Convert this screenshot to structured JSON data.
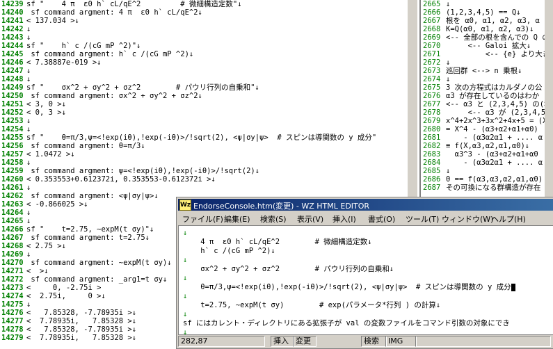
{
  "left_pane": {
    "lines": [
      {
        "num": "14239",
        "text": "sf \"    4 π  ε0 h` cL/qE^2         # 微細構造定数\"↓"
      },
      {
        "num": "14240",
        "text": " sf command argment: 4 π  ε0 h` cL/qE^2↓"
      },
      {
        "num": "14241",
        "text": "< 137.034 >↓"
      },
      {
        "num": "14242",
        "text": "↓"
      },
      {
        "num": "14243",
        "text": "↓"
      },
      {
        "num": "14244",
        "text": "sf \"    h` c /(cG mP ^2)\"↓"
      },
      {
        "num": "14245",
        "text": " sf command argment: h` c /(cG mP ^2)↓"
      },
      {
        "num": "14246",
        "text": "< 7.38887e-019 >↓"
      },
      {
        "num": "14247",
        "text": "↓"
      },
      {
        "num": "14248",
        "text": "↓"
      },
      {
        "num": "14249",
        "text": "sf \"    σx^2 + σy^2 + σz^2        # パウリ行列の自乗和\"↓"
      },
      {
        "num": "14250",
        "text": " sf command argment: σx^2 + σy^2 + σz^2↓"
      },
      {
        "num": "14251",
        "text": "< 3, 0 >↓"
      },
      {
        "num": "14252",
        "text": "< 0, 3 >↓"
      },
      {
        "num": "14253",
        "text": "↓"
      },
      {
        "num": "14254",
        "text": "↓"
      },
      {
        "num": "14255",
        "text": "sf \"    θ=π/3,ψ=<!exp(iθ),!exp(-iθ)>/!sqrt(2), <ψ|σy|ψ>  # スピンは導関数の y 成分\""
      },
      {
        "num": "14256",
        "text": " sf command argment: θ=π/3↓"
      },
      {
        "num": "14257",
        "text": "< 1.0472 >↓"
      },
      {
        "num": "14258",
        "text": "↓"
      },
      {
        "num": "14259",
        "text": " sf command argment: ψ=<!exp(iθ),!exp(-iθ)>/!sqrt(2)↓"
      },
      {
        "num": "14260",
        "text": "< 0.353553+0.612372i, 0.353553-0.612372i >↓"
      },
      {
        "num": "14261",
        "text": "↓"
      },
      {
        "num": "14262",
        "text": " sf command argment: <ψ|σy|ψ>↓"
      },
      {
        "num": "14263",
        "text": "< -0.866025 >↓"
      },
      {
        "num": "14264",
        "text": "↓"
      },
      {
        "num": "14265",
        "text": "↓"
      },
      {
        "num": "14266",
        "text": "sf \"    t=2.75, ~expM(t σy)\"↓"
      },
      {
        "num": "14267",
        "text": " sf command argment: t=2.75↓"
      },
      {
        "num": "14268",
        "text": "< 2.75 >↓"
      },
      {
        "num": "14269",
        "text": "↓"
      },
      {
        "num": "14270",
        "text": " sf command argment: ~expM(t σy)↓"
      },
      {
        "num": "14271",
        "text": "<  >↓"
      },
      {
        "num": "14272",
        "text": " sf command argment: _arg1=t σy↓"
      },
      {
        "num": "14273",
        "text": "<     0, -2.75i >"
      },
      {
        "num": "14274",
        "text": "<  2.75i,     0 >↓"
      },
      {
        "num": "14275",
        "text": "↓"
      },
      {
        "num": "14276",
        "text": "<   7.85328, -7.78935i >↓"
      },
      {
        "num": "14277",
        "text": "<  7.78935i,   7.85328 >↓"
      },
      {
        "num": "14278",
        "text": "<   7.85328, -7.78935i >↓"
      },
      {
        "num": "14279",
        "text": "<  7.78935i,   7.85328 >↓"
      }
    ]
  },
  "right_pane": {
    "lines": [
      {
        "num": "2665",
        "text": "↓"
      },
      {
        "num": "2666",
        "text": "(1,2,3,4,5) == Q↓"
      },
      {
        "num": "2667",
        "text": "根を α0, α1, α2, α3, α"
      },
      {
        "num": "2668",
        "text": "K=Q(α0, α1, α2, α3)↓"
      },
      {
        "num": "2669",
        "text": "<-- 全部の根を含んでの Q の"
      },
      {
        "num": "2670",
        "text": "     <-- Galoi 拡大↓"
      },
      {
        "num": "2671",
        "text": "         <-- {e} より大きい"
      },
      {
        "num": "2672",
        "text": "↓"
      },
      {
        "num": "2673",
        "text": "巡回群 <--> n 乗根↓"
      },
      {
        "num": "2674",
        "text": "↓"
      },
      {
        "num": "2675",
        "text": "3 次の方程式はカルダノの公"
      },
      {
        "num": "2676",
        "text": "α3 が存在しているのはわか"
      },
      {
        "num": "2677",
        "text": "<-- α3 と (2,3,4,5) の(移"
      },
      {
        "num": "2678",
        "text": "     <-- α3 が (2,3,4,5) と"
      },
      {
        "num": "2679",
        "text": "x^4+2x^3+3x^2+4x+5 = (X-α"
      },
      {
        "num": "2680",
        "text": "= X^4 - (α3+α2+α1+α0)"
      },
      {
        "num": "2681",
        "text": "    - (α3α2α1 + .... α"
      },
      {
        "num": "2682",
        "text": "≡ f(X,α3,α2,α1,α0)↓"
      },
      {
        "num": "2683",
        "text": "  α3^3 - (α3+α2+α1+α0"
      },
      {
        "num": "2684",
        "text": "    - (α3α2α1 + .... α"
      },
      {
        "num": "2685",
        "text": "↓"
      },
      {
        "num": "2686",
        "text": "0 == f(α3,α3,α2,α1,α0)"
      },
      {
        "num": "2687",
        "text": "その可換になる群構造が存在"
      }
    ]
  },
  "editor": {
    "icon_label": "Wz",
    "title": "EndorseConsole.htm(変更) - WZ HTML EDITOR",
    "menus": [
      "ファイル(F)",
      "編集(E)",
      "検索(S)",
      "表示(V)",
      "挿入(I)",
      "書式(O)",
      "ツール(T)",
      "ウィンドウ(W)",
      "ヘルプ(H)"
    ],
    "lines": [
      {
        "prefix": "↓",
        "text": ""
      },
      {
        "prefix": "",
        "text": "    4 π  ε0 h` cL/qE^2        # 微細構造定数↓"
      },
      {
        "prefix": "",
        "text": "    h` c /(cG mP ^2)↓"
      },
      {
        "prefix": "↓",
        "text": ""
      },
      {
        "prefix": "",
        "text": "    σx^2 + σy^2 + σz^2        # パウリ行列の自乗和↓"
      },
      {
        "prefix": "↓",
        "text": ""
      },
      {
        "prefix": "",
        "text": "    θ=π/3,ψ=<!exp(iθ),!exp(-iθ)>/!sqrt(2), <ψ|σy|ψ>  # スピンは導関数の y 成分"
      },
      {
        "prefix": "↓",
        "text": ""
      },
      {
        "prefix": "",
        "text": "    t=2.75, ~expM(t σy)        # exp(パラメータ*行列 ) の計算↓"
      },
      {
        "prefix": "↓",
        "text": ""
      },
      {
        "prefix": "",
        "text": "sf にはカレント・ディレクトリにある拡張子が val の変数ファイルをコマンド引数の対象にでき"
      },
      {
        "prefix": "↓",
        "text": ""
      }
    ],
    "status": {
      "position": "282,87",
      "insert": "挿入",
      "modified": "変更",
      "search": "検索",
      "ime": "IMG"
    }
  }
}
